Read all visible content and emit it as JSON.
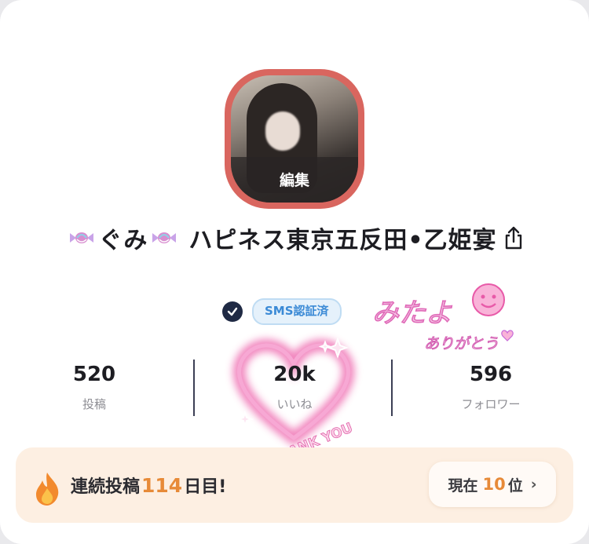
{
  "profile": {
    "avatar_edit_label": "編集",
    "display_name": "ぐみ",
    "shop_name": "ハピネス東京五反田•乙姫宴",
    "sms_badge": "SMS認証済"
  },
  "stamps": {
    "mitayo": "みたよ",
    "arigatou": "ありがとう",
    "thank_you": "THANK YOU"
  },
  "stats": [
    {
      "value": "520",
      "label": "投稿"
    },
    {
      "value": "20k",
      "label": "いいね"
    },
    {
      "value": "596",
      "label": "フォロワー"
    }
  ],
  "streak": {
    "prefix": "連続投稿",
    "count": "114",
    "suffix": "日目!",
    "rank_prefix": "現在",
    "rank_value": "10",
    "rank_unit": "位",
    "chevron": "›"
  },
  "colors": {
    "accent": "#e78a38",
    "avatar_ring": "#d9665f",
    "badge_blue": "#3b8ad6",
    "heart_pink": "#f06ab0"
  },
  "icons": [
    "candy-icon",
    "share-icon",
    "verified-check-icon",
    "flame-icon",
    "chevron-right-icon"
  ]
}
